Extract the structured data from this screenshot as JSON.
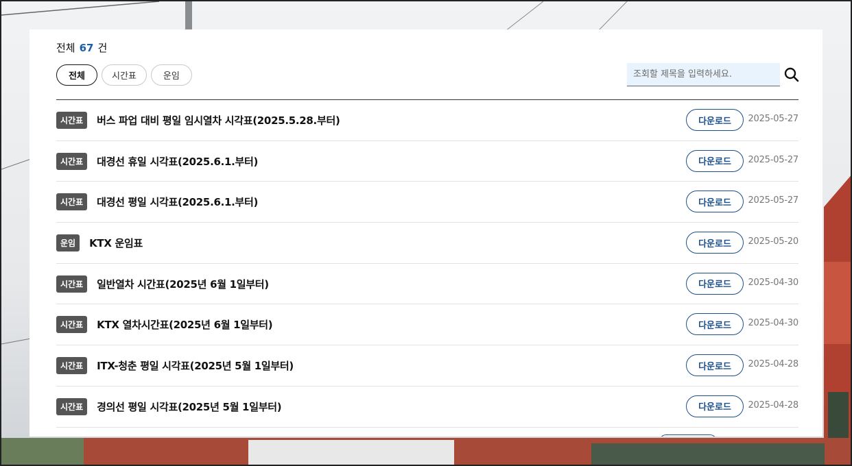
{
  "summary": {
    "label": "전체",
    "count": "67",
    "unit": "건"
  },
  "filters": [
    {
      "label": "전체",
      "active": true
    },
    {
      "label": "시간표",
      "active": false
    },
    {
      "label": "운임",
      "active": false
    }
  ],
  "search": {
    "placeholder": "조회할 제목을 입력하세요.",
    "value": "",
    "icon": "search-icon"
  },
  "list": {
    "button_label": "다운로드",
    "rows": [
      {
        "category": "시간표",
        "title": "버스 파업 대비 평일 임시열차 시각표(2025.5.28.부터)",
        "date": "2025-05-27"
      },
      {
        "category": "시간표",
        "title": "대경선 휴일 시각표(2025.6.1.부터)",
        "date": "2025-05-27"
      },
      {
        "category": "시간표",
        "title": "대경선 평일 시각표(2025.6.1.부터)",
        "date": "2025-05-27"
      },
      {
        "category": "운임",
        "title": "KTX 운임표",
        "date": "2025-05-20"
      },
      {
        "category": "시간표",
        "title": "일반열차 시간표(2025년 6월 1일부터)",
        "date": "2025-04-30"
      },
      {
        "category": "시간표",
        "title": "KTX 열차시간표(2025년 6월 1일부터)",
        "date": "2025-04-30"
      },
      {
        "category": "시간표",
        "title": "ITX-청춘 평일 시각표(2025년 5월 1일부터)",
        "date": "2025-04-28"
      },
      {
        "category": "시간표",
        "title": "경의선 평일 시각표(2025년 5월 1일부터)",
        "date": "2025-04-28"
      }
    ]
  },
  "colors": {
    "accent": "#1a4f8b",
    "badge": "#555555",
    "count": "#1a5fa8",
    "search_bg": "#e9f3fd"
  }
}
